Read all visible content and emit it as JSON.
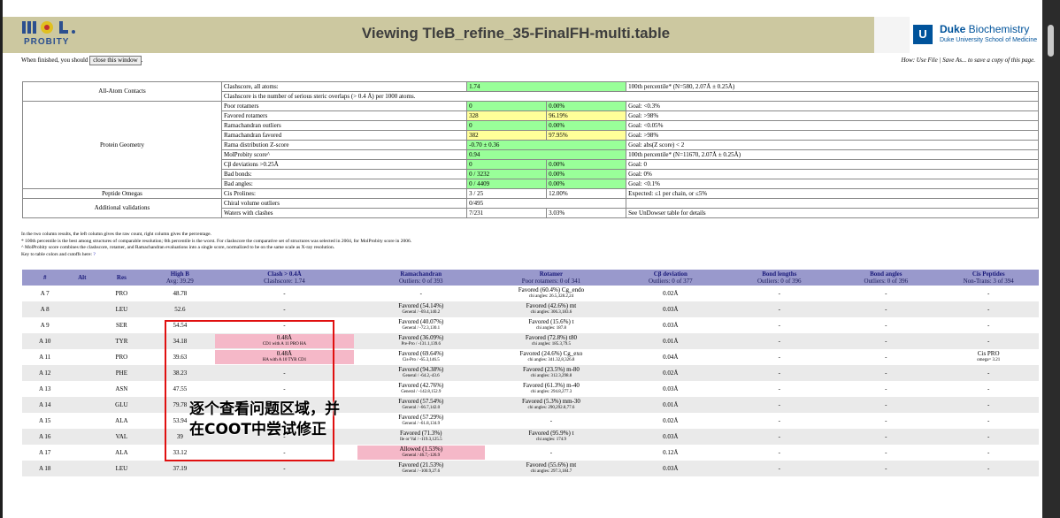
{
  "header": {
    "title": "Viewing TleB_refine_35-FinalFH-multi.table",
    "logo_text": "PROBITY",
    "duke_name_bold": "Duke",
    "duke_name_rest": " Biochemistry",
    "duke_sub": "Duke University School of Medicine",
    "duke_shield": "U"
  },
  "instructions": {
    "prefix": "When finished, you should",
    "button": "close this window",
    "suffix": ".",
    "howto": "How: Use File | Save As... to save a copy of this page."
  },
  "summary": {
    "allatom_label": "All-Atom Contacts",
    "clashscore_label": "Clashscore, all atoms:",
    "clashscore_value": "1.74",
    "clashscore_goal": "100th percentile* (N=580, 2.07Å ± 0.25Å)",
    "clashscore_desc": "Clashscore is the number of serious steric overlaps (> 0.4 Å) per 1000 atoms.",
    "protein_label": "Protein Geometry",
    "rows": [
      {
        "label": "Poor rotamers",
        "v1": "0",
        "v2": "0.00%",
        "goal": "Goal: <0.3%",
        "c1": "green",
        "c2": "green"
      },
      {
        "label": "Favored rotamers",
        "v1": "328",
        "v2": "96.19%",
        "goal": "Goal: >98%",
        "c1": "yellow",
        "c2": "yellow"
      },
      {
        "label": "Ramachandran outliers",
        "v1": "0",
        "v2": "0.00%",
        "goal": "Goal: <0.05%",
        "c1": "green",
        "c2": "green"
      },
      {
        "label": "Ramachandran favored",
        "v1": "382",
        "v2": "97.95%",
        "goal": "Goal: >98%",
        "c1": "yellow",
        "c2": "yellow"
      },
      {
        "label": "Rama distribution Z-score",
        "v1": "-0.70 ± 0.36",
        "v2": "",
        "goal": "Goal: abs(Z score) < 2",
        "c1": "green",
        "c2": "green",
        "span": true
      },
      {
        "label": "MolProbity score^",
        "v1": "0.94",
        "v2": "",
        "goal": "100th percentile* (N=11670, 2.07Å ± 0.25Å)",
        "c1": "green",
        "c2": "green",
        "span": true
      },
      {
        "label": "Cβ deviations >0.25Å",
        "v1": "0",
        "v2": "0.00%",
        "goal": "Goal: 0",
        "c1": "green",
        "c2": "green"
      },
      {
        "label": "Bad bonds:",
        "v1": "0 / 3232",
        "v2": "0.00%",
        "goal": "Goal: 0%",
        "c1": "green",
        "c2": "green"
      },
      {
        "label": "Bad angles:",
        "v1": "0 / 4409",
        "v2": "0.00%",
        "goal": "Goal: <0.1%",
        "c1": "green",
        "c2": "green"
      }
    ],
    "omega_label": "Peptide Omegas",
    "omega_row": {
      "label": "Cis Prolines:",
      "v1": "3 / 25",
      "v2": "12.00%",
      "goal": "Expected: ≤1 per chain, or ≤5%"
    },
    "addl_label": "Additional validations",
    "chiral_row": {
      "label": "Chiral volume outliers",
      "v1": "0/495"
    },
    "waters_row": {
      "label": "Waters with clashes",
      "v1": "7/231",
      "v2": "3.03%",
      "goal": "See UnDowser table for details"
    }
  },
  "notes": {
    "n1": "In the two column results, the left column gives the raw count, right column gives the percentage.",
    "n2": "* 100th percentile is the best among structures of comparable resolution; 0th percentile is the worst. For clashscore the comparative set of structures was selected in 2004, for MolProbity score in 2006.",
    "n3": "^ MolProbity score combines the clashscore, rotamer, and Ramachandran evaluations into a single score, normalized to be on the same scale as X-ray resolution.",
    "n4": "Key to table colors and cutoffs here:",
    "n4_link": "?"
  },
  "residue_table": {
    "headers": [
      {
        "label": "#",
        "sub": ""
      },
      {
        "label": "Alt",
        "sub": ""
      },
      {
        "label": "Res",
        "sub": ""
      },
      {
        "label": "High B",
        "sub": "Avg: 39.29"
      },
      {
        "label": "Clash > 0.4Å",
        "sub": "Clashscore: 1.74"
      },
      {
        "label": "Ramachandran",
        "sub": "Outliers: 0 of 393"
      },
      {
        "label": "Rotamer",
        "sub": "Poor rotamers: 0 of 341"
      },
      {
        "label": "Cβ deviation",
        "sub": "Outliers: 0 of 377"
      },
      {
        "label": "Bond lengths",
        "sub": "Outliers: 0 of 396"
      },
      {
        "label": "Bond angles",
        "sub": "Outliers: 0 of 396"
      },
      {
        "label": "Cis Peptides",
        "sub": "Non-Trans: 3 of 394"
      }
    ],
    "rows": [
      {
        "num": "A 7",
        "res": "PRO",
        "b": "48.78",
        "clash": "-",
        "clash2": "",
        "rama": "-",
        "rama2": "",
        "rot": "Favored (60.4%) Cg_endo",
        "rot2": "chi angles: 26.5,328.2,24",
        "cb": "0.02Å",
        "bl": "-",
        "ba": "-",
        "cis": "-",
        "cis2": ""
      },
      {
        "num": "A 8",
        "res": "LEU",
        "b": "52.6",
        "clash": "-",
        "clash2": "",
        "rama": "Favored (54.14%)",
        "rama2": "General / -69.4,140.2",
        "rot": "Favored (42.6%) mt",
        "rot2": "chi angles: 306.3,183.6",
        "cb": "0.03Å",
        "bl": "-",
        "ba": "-",
        "cis": "-",
        "cis2": ""
      },
      {
        "num": "A 9",
        "res": "SER",
        "b": "54.54",
        "clash": "-",
        "clash2": "",
        "rama": "Favored (40.07%)",
        "rama2": "General / -72.3,130.1",
        "rot": "Favored (15.6%) t",
        "rot2": "chi angles: 187.8",
        "cb": "0.03Å",
        "bl": "-",
        "ba": "-",
        "cis": "-",
        "cis2": ""
      },
      {
        "num": "A 10",
        "res": "TYR",
        "b": "34.18",
        "clash": "0.48Å",
        "clash2": "CD1 with A 11 PRO HA",
        "rama": "Favored (36.09%)",
        "rama2": "Pre-Pro / -131.1,139.6",
        "rot": "Favored (72.8%) t80",
        "rot2": "chi angles: 185.3,79.5",
        "cb": "0.01Å",
        "bl": "-",
        "ba": "-",
        "cis": "-",
        "cis2": ""
      },
      {
        "num": "A 11",
        "res": "PRO",
        "b": "39.63",
        "clash": "0.48Å",
        "clash2": "HA with A 10 TYR CD1",
        "rama": "Favored (69.64%)",
        "rama2": "Cis-Pro / -65.3,146.5",
        "rot": "Favored (24.6%) Cg_exo",
        "rot2": "chi angles: 341.32,8,326.8",
        "cb": "0.04Å",
        "bl": "-",
        "ba": "-",
        "cis": "Cis PRO",
        "cis2": "omega= 3.21"
      },
      {
        "num": "A 12",
        "res": "PHE",
        "b": "38.23",
        "clash": "-",
        "clash2": "",
        "rama": "Favored (94.38%)",
        "rama2": "General / -64.2,-43.6",
        "rot": "Favored (23.5%) m-80",
        "rot2": "chi angles: 312.3,298.8",
        "cb": "0.02Å",
        "bl": "-",
        "ba": "-",
        "cis": "-",
        "cis2": ""
      },
      {
        "num": "A 13",
        "res": "ASN",
        "b": "47.55",
        "clash": "-",
        "clash2": "",
        "rama": "Favored (42.76%)",
        "rama2": "General / -142.8,152.9",
        "rot": "Favored (61.3%) m-40",
        "rot2": "chi angles: 294.8,277.3",
        "cb": "0.03Å",
        "bl": "-",
        "ba": "-",
        "cis": "-",
        "cis2": ""
      },
      {
        "num": "A 14",
        "res": "GLU",
        "b": "79.78",
        "clash": "-",
        "clash2": "",
        "rama": "Favored (57.54%)",
        "rama2": "General / -66.7,142.0",
        "rot": "Favored (5.3%) mm-30",
        "rot2": "chi angles: 290,292.8,77.6",
        "cb": "0.01Å",
        "bl": "-",
        "ba": "-",
        "cis": "-",
        "cis2": ""
      },
      {
        "num": "A 15",
        "res": "ALA",
        "b": "53.94",
        "clash": "-",
        "clash2": "",
        "rama": "Favored (57.29%)",
        "rama2": "General / -61.8,134.9",
        "rot": "-",
        "rot2": "",
        "cb": "0.02Å",
        "bl": "-",
        "ba": "-",
        "cis": "-",
        "cis2": ""
      },
      {
        "num": "A 16",
        "res": "VAL",
        "b": "39",
        "clash": "-",
        "clash2": "",
        "rama": "Favored (71.3%)",
        "rama2": "Ile or Val / -119.3,125.5",
        "rot": "Favored (95.9%) t",
        "rot2": "chi angles: 174.9",
        "cb": "0.03Å",
        "bl": "-",
        "ba": "-",
        "cis": "-",
        "cis2": ""
      },
      {
        "num": "A 17",
        "res": "ALA",
        "b": "33.12",
        "clash": "-",
        "clash2": "",
        "rama": "Allowed (1.53%)",
        "rama2": "General / 46.7,-126.9",
        "rot": "-",
        "rot2": "",
        "cb": "0.12Å",
        "bl": "-",
        "ba": "-",
        "cis": "-",
        "cis2": "",
        "rama_pink": true
      },
      {
        "num": "A 18",
        "res": "LEU",
        "b": "37.19",
        "clash": "-",
        "clash2": "",
        "rama": "Favored (21.53%)",
        "rama2": "General / -100.9,27.6",
        "rot": "Favored (55.6%) mt",
        "rot2": "chi angles: 297.3,184.7",
        "cb": "0.03Å",
        "bl": "-",
        "ba": "-",
        "cis": "-",
        "cis2": ""
      }
    ]
  },
  "annotation": {
    "text": "逐个查看问题区域，并在COOT中尝试修正"
  }
}
